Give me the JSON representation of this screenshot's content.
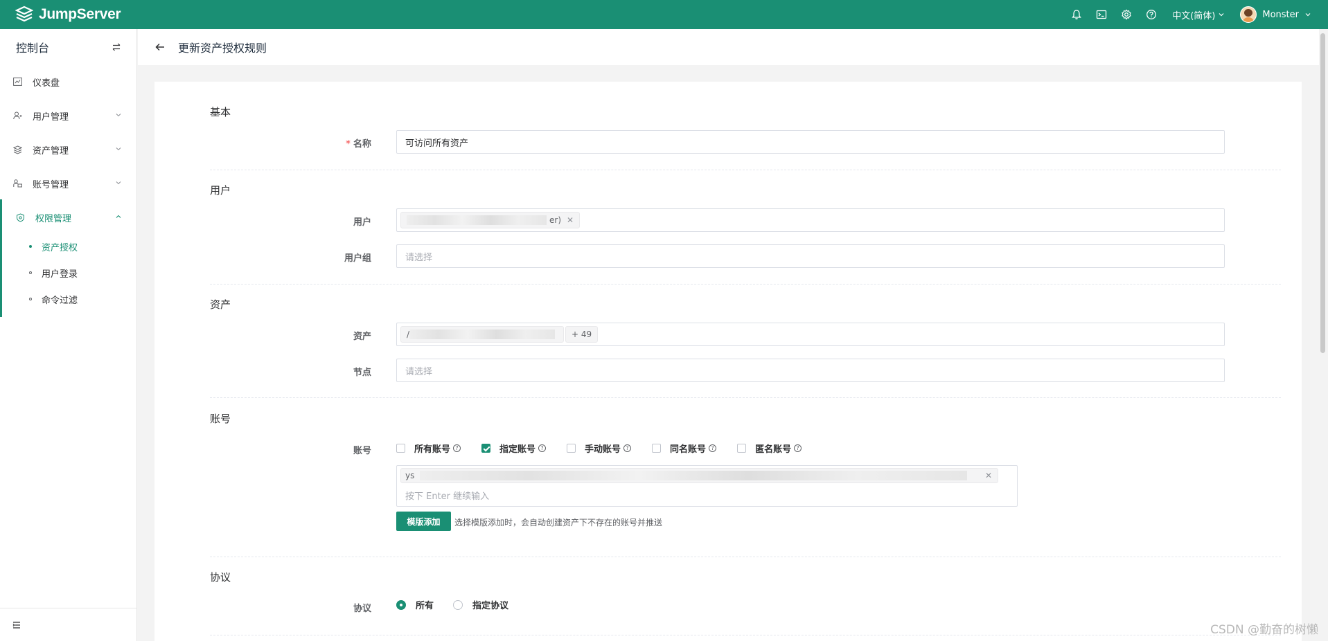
{
  "app": {
    "name": "JumpServer"
  },
  "topbar": {
    "language": "中文(简体)",
    "username": "Monster"
  },
  "sidebar": {
    "title": "控制台",
    "items": [
      {
        "label": "仪表盘"
      },
      {
        "label": "用户管理"
      },
      {
        "label": "资产管理"
      },
      {
        "label": "账号管理"
      },
      {
        "label": "权限管理"
      }
    ],
    "subitems": [
      {
        "label": "资产授权"
      },
      {
        "label": "用户登录"
      },
      {
        "label": "命令过滤"
      }
    ]
  },
  "page": {
    "title": "更新资产授权规则"
  },
  "form": {
    "basic": {
      "title": "基本",
      "name_label": "名称",
      "name_value": "可访问所有资产"
    },
    "user": {
      "title": "用户",
      "users_label": "用户",
      "user_tag_suffix": "er)",
      "groups_label": "用户组",
      "groups_placeholder": "请选择"
    },
    "asset": {
      "title": "资产",
      "assets_label": "资产",
      "asset_tag_prefix": "/",
      "asset_more": "+ 49",
      "nodes_label": "节点",
      "nodes_placeholder": "请选择"
    },
    "account": {
      "title": "账号",
      "accounts_label": "账号",
      "options": [
        {
          "label": "所有账号",
          "checked": false
        },
        {
          "label": "指定账号",
          "checked": true
        },
        {
          "label": "手动账号",
          "checked": false
        },
        {
          "label": "同名账号",
          "checked": false
        },
        {
          "label": "匿名账号",
          "checked": false
        }
      ],
      "tag_prefix": "ys",
      "input_placeholder": "按下 Enter 继续输入",
      "template_button": "模版添加",
      "template_hint": "选择模版添加时，会自动创建资产下不存在的账号并推送"
    },
    "protocol": {
      "title": "协议",
      "protocols_label": "协议",
      "options": [
        {
          "label": "所有",
          "selected": true
        },
        {
          "label": "指定协议",
          "selected": false
        }
      ]
    }
  },
  "watermark": "CSDN @勤奋的树懒",
  "colors": {
    "brand": "#1a8f74"
  }
}
